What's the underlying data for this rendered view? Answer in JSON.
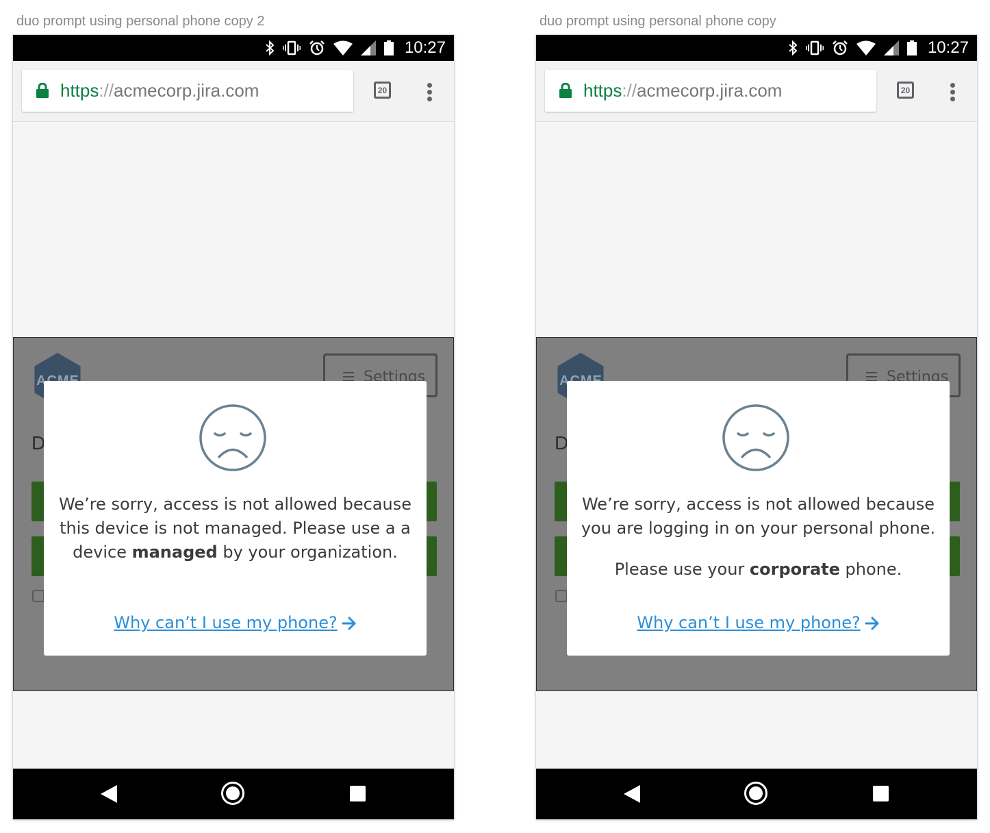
{
  "artboards": [
    {
      "title": "duo prompt using personal phone copy 2",
      "status_time": "10:27",
      "url": {
        "scheme": "https",
        "separator": "://",
        "host": "acmecorp.jira.com"
      },
      "tab_count": "20",
      "background": {
        "logo_text": "ACME",
        "settings_label": "Settings",
        "heading_initial": "D"
      },
      "modal": {
        "message_part1": "We’re sorry, access is not allowed because this device is not managed. Please use a a device ",
        "message_bold": "managed",
        "message_part2": " by your organization.",
        "second_line_pre": "",
        "second_line_bold": "",
        "second_line_post": "",
        "link_text": "Why can’t I use my phone?"
      }
    },
    {
      "title": "duo prompt using personal phone copy",
      "status_time": "10:27",
      "url": {
        "scheme": "https",
        "separator": "://",
        "host": "acmecorp.jira.com"
      },
      "tab_count": "20",
      "background": {
        "logo_text": "ACME",
        "settings_label": "Settings",
        "heading_initial": "D"
      },
      "modal": {
        "message_part1": "We’re sorry, access is not allowed because you are logging in on your personal phone.",
        "message_bold": "",
        "message_part2": "",
        "second_line_pre": "Please use your ",
        "second_line_bold": "corporate",
        "second_line_post": " phone.",
        "link_text": "Why can’t I use my phone?"
      }
    }
  ],
  "colors": {
    "link": "#2b8ed8",
    "url_scheme": "#0b8043",
    "overlay": "#808080",
    "face_stroke": "#6a8291"
  }
}
